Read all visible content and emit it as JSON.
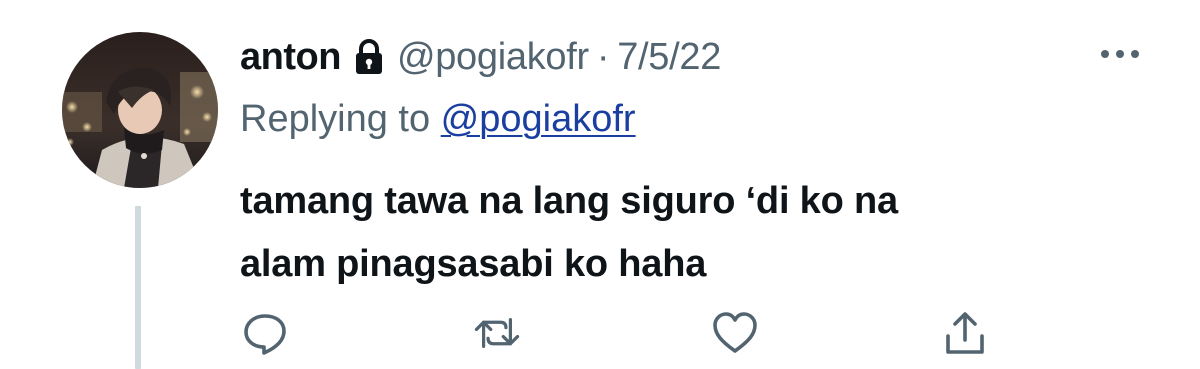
{
  "tweet": {
    "display_name": "anton",
    "protected": true,
    "handle": "@pogiakofr",
    "separator": "·",
    "date": "7/5/22",
    "replying_prefix": "Replying to",
    "replying_to": "@pogiakofr",
    "text_line1": "tamang tawa na lang siguro ‘di ko na",
    "text_line2": "alam pinagsasabi ko haha"
  },
  "icons": {
    "lock": "lock-icon",
    "more": "more-icon",
    "reply": "reply-icon",
    "retweet": "retweet-icon",
    "like": "heart-icon",
    "share": "share-icon"
  },
  "colors": {
    "text_primary": "#0f1419",
    "text_secondary": "#536471",
    "mention_link": "#1a3fa0",
    "thread_line": "#cfd9de"
  }
}
